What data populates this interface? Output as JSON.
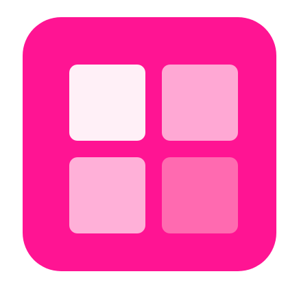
{
  "icon": {
    "name": "grid-app-icon",
    "background_color": "#ff1493",
    "tiles": [
      {
        "name": "top-left",
        "color": "#fff0f7"
      },
      {
        "name": "top-right",
        "color": "#ffa8d4"
      },
      {
        "name": "bottom-left",
        "color": "#ffb0d8"
      },
      {
        "name": "bottom-right",
        "color": "#ff6ab0"
      }
    ]
  }
}
